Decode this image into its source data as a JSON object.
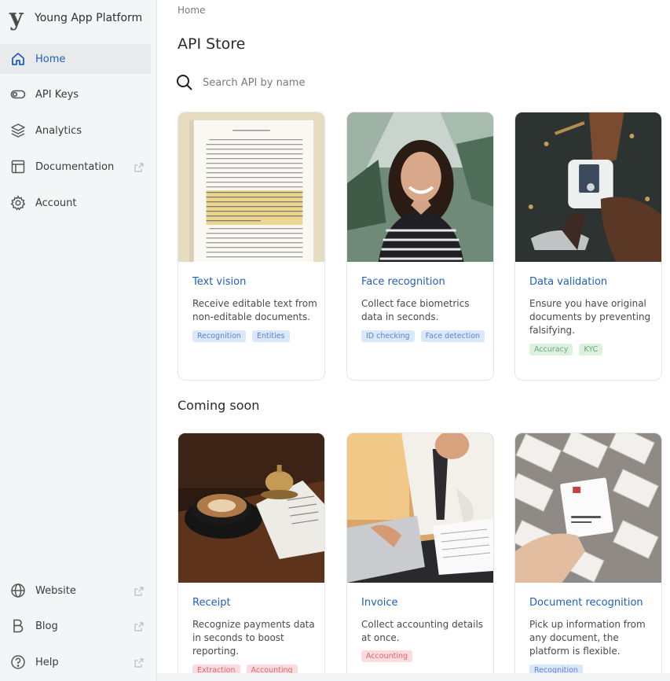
{
  "brand": {
    "logo": "y",
    "name": "Young App Platform"
  },
  "sidebar": {
    "items": [
      {
        "label": "Home",
        "icon": "home-icon",
        "active": true
      },
      {
        "label": "API Keys",
        "icon": "toggle-key-icon"
      },
      {
        "label": "Analytics",
        "icon": "layers-icon"
      },
      {
        "label": "Documentation",
        "icon": "layout-doc-icon",
        "external": true
      },
      {
        "label": "Account",
        "icon": "gear-icon"
      }
    ],
    "bottom_items": [
      {
        "label": "Website",
        "icon": "globe-icon",
        "external": true
      },
      {
        "label": "Blog",
        "icon": "blog-b-icon",
        "external": true
      },
      {
        "label": "Help",
        "icon": "help-circle-icon",
        "external": true
      }
    ]
  },
  "main": {
    "breadcrumb": "Home",
    "title": "API Store",
    "search": {
      "placeholder": "Search API by name",
      "value": ""
    },
    "coming_soon_title": "Coming soon"
  },
  "cards": [
    {
      "title": "Text vision",
      "description": "Receive editable text from non-editable documents.",
      "image": "document-page-image",
      "tags": [
        {
          "label": "Recognition",
          "color": "blue"
        },
        {
          "label": "Entities",
          "color": "blue"
        }
      ]
    },
    {
      "title": "Face recognition",
      "description": "Collect face biometrics data in seconds.",
      "image": "smiling-woman-image",
      "tags": [
        {
          "label": "ID checking",
          "color": "blue"
        },
        {
          "label": "Face detection",
          "color": "blue"
        }
      ]
    },
    {
      "title": "Data validation",
      "description": "Ensure you have original documents by preventing falsifying.",
      "image": "card-reader-image",
      "tags": [
        {
          "label": "Accuracy",
          "color": "green"
        },
        {
          "label": "KYC",
          "color": "green"
        }
      ]
    }
  ],
  "coming_soon_cards": [
    {
      "title": "Receipt",
      "description": "Recognize payments data in seconds to boost reporting.",
      "image": "coffee-receipt-image",
      "tags": [
        {
          "label": "Extraction",
          "color": "red"
        },
        {
          "label": "Accounting",
          "color": "red"
        }
      ]
    },
    {
      "title": "Invoice",
      "description": "Collect accounting details at once.",
      "image": "businessman-invoice-image",
      "tags": [
        {
          "label": "Accounting",
          "color": "red"
        }
      ]
    },
    {
      "title": "Document recognition",
      "description": "Pick up information from any document, the platform is flexible.",
      "image": "boarding-passes-image",
      "tags": [
        {
          "label": "Recognition",
          "color": "blue"
        }
      ]
    }
  ],
  "colors": {
    "accent": "#1f5fbf",
    "sidebar_bg": "#f4f5f6",
    "tag_blue": "#dbe7fb",
    "tag_green": "#dcf1df",
    "tag_red": "#fbdbdd"
  }
}
